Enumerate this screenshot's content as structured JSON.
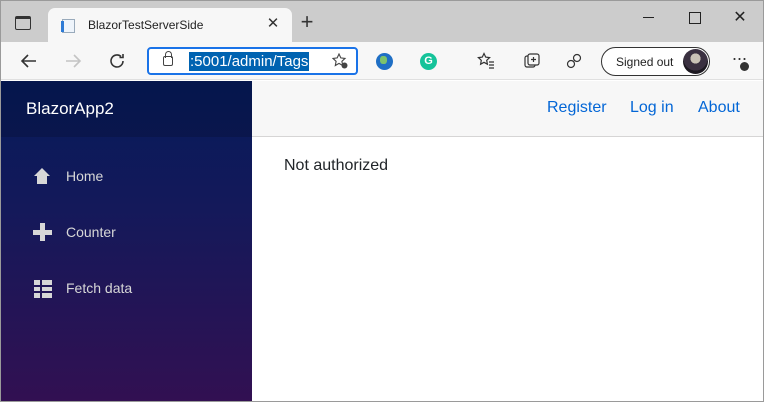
{
  "browser": {
    "tab_title": "BlazorTestServerSide",
    "tab_close": "✕",
    "new_tab": "+",
    "win_close": "✕",
    "address": ":5001/admin/Tags",
    "profile_label": "Signed out",
    "menu": "···",
    "icons": [
      "window-icon",
      "back-arrow-icon",
      "forward-arrow-icon",
      "reload-icon",
      "lock-icon",
      "add-favorite-icon",
      "globe-extension-icon",
      "grammarly-extension-icon",
      "favorites-icon",
      "collections-icon",
      "extensions-icon",
      "avatar",
      "more-menu-icon"
    ],
    "grammarly_glyph": "G"
  },
  "app": {
    "brand": "BlazorApp2",
    "sidebar_colors": {
      "top": "#061a5b",
      "bottom": "#321052"
    },
    "nav": [
      {
        "label": "Home",
        "icon": "home-icon"
      },
      {
        "label": "Counter",
        "icon": "plus-icon"
      },
      {
        "label": "Fetch data",
        "icon": "list-icon"
      }
    ],
    "top_links": [
      "Register",
      "Log in",
      "About"
    ],
    "link_color": "#0366d6",
    "message": "Not authorized"
  }
}
